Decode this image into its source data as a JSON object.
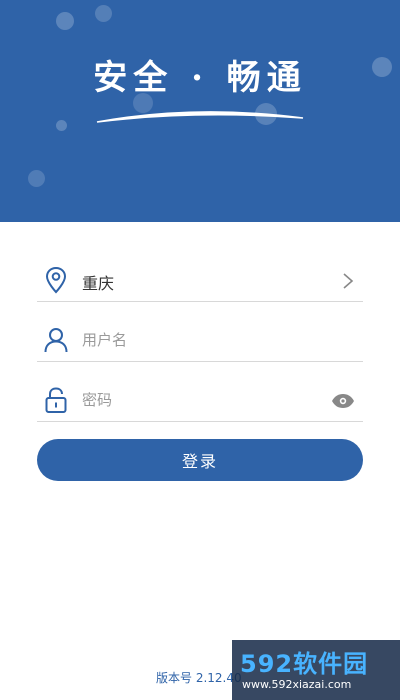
{
  "header": {
    "slogan": "安全 · 畅通",
    "background_color": "#2f63a8"
  },
  "form": {
    "city": {
      "icon": "location-pin-icon",
      "value": "重庆",
      "action_icon": "chevron-right-icon"
    },
    "username": {
      "icon": "user-icon",
      "placeholder": "用户名"
    },
    "password": {
      "icon": "lock-icon",
      "placeholder": "密码",
      "action_icon": "eye-icon"
    },
    "login_label": "登录"
  },
  "footer": {
    "version": "版本号 2.12.40"
  },
  "watermark": {
    "logo": "592软件园",
    "url": "www.592xiazai.com"
  },
  "colors": {
    "accent": "#2f63a8",
    "divider": "#d8d8d8"
  }
}
